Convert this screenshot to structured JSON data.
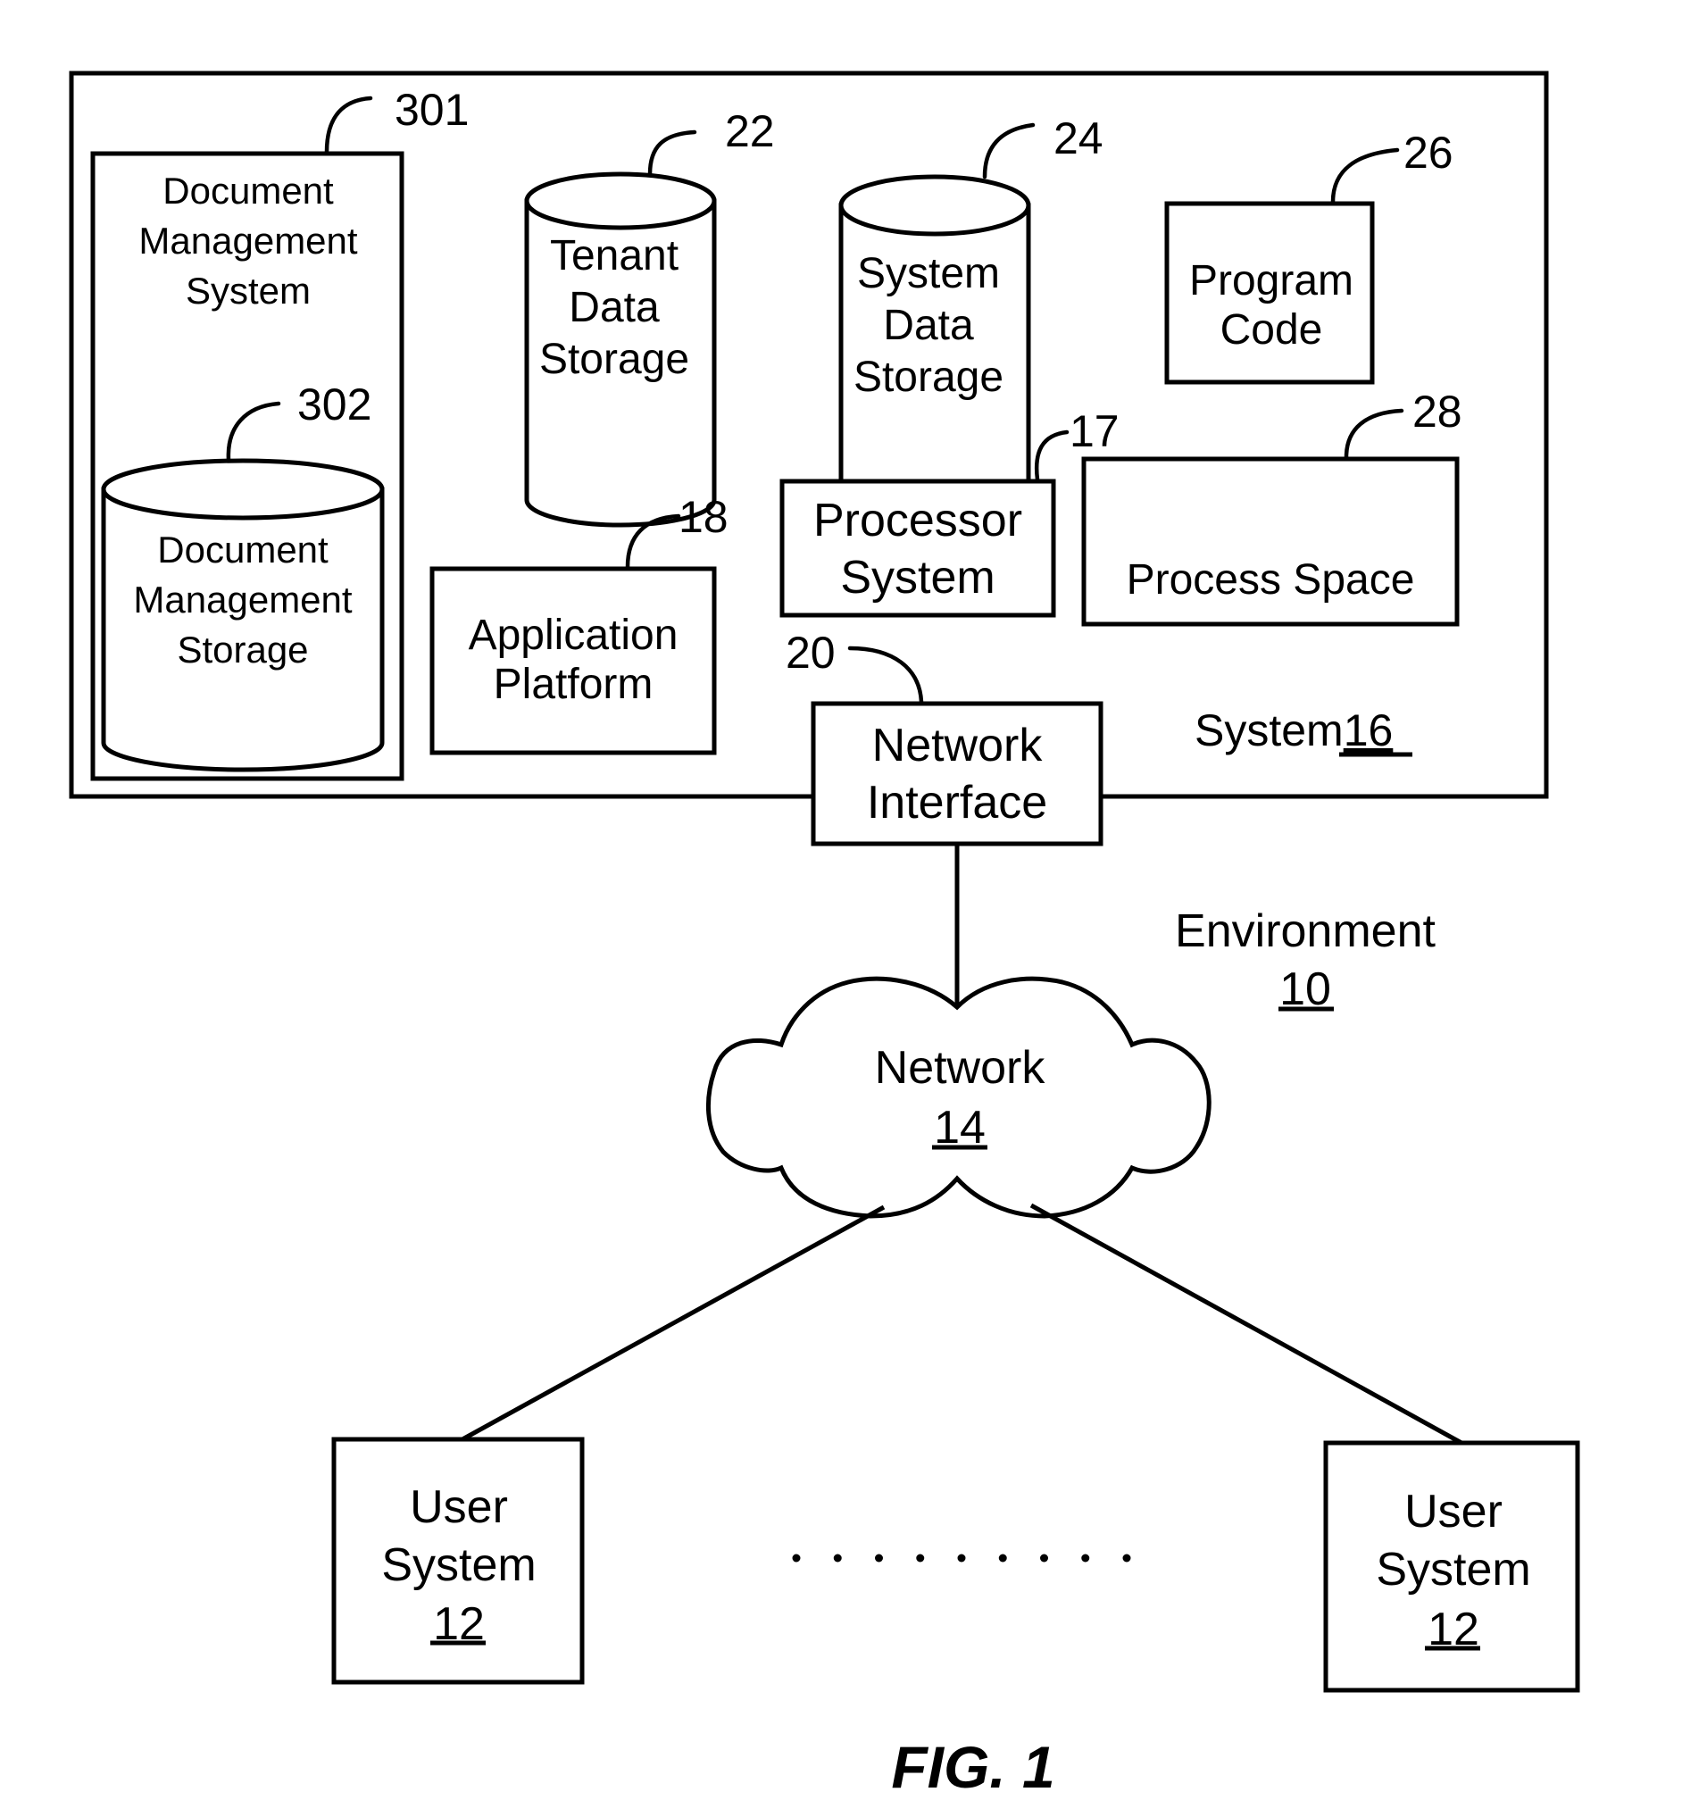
{
  "figure": {
    "caption": "FIG. 1",
    "environment": {
      "label": "Environment",
      "ref": "10"
    },
    "system": {
      "label": "System",
      "ref": "16"
    },
    "components": {
      "document_management_system": {
        "lines": [
          "Document",
          "Management",
          "System"
        ],
        "ref": "301"
      },
      "document_management_storage": {
        "lines": [
          "Document",
          "Management",
          "Storage"
        ],
        "ref": "302"
      },
      "tenant_data_storage": {
        "lines": [
          "Tenant",
          "Data",
          "Storage"
        ],
        "ref": "22"
      },
      "system_data_storage": {
        "lines": [
          "System",
          "Data",
          "Storage"
        ],
        "ref": "24"
      },
      "program_code": {
        "lines": [
          "Program",
          "Code"
        ],
        "ref": "26"
      },
      "processor_system": {
        "lines": [
          "Processor",
          "System"
        ],
        "ref": "17"
      },
      "process_space": {
        "lines": [
          "Process Space"
        ],
        "ref": "28"
      },
      "application_platform": {
        "lines": [
          "Application",
          "Platform"
        ],
        "ref": "18"
      },
      "network_interface": {
        "lines": [
          "Network",
          "Interface"
        ],
        "ref": "20"
      }
    },
    "network": {
      "label": "Network",
      "ref": "14"
    },
    "user_systems": [
      {
        "lines": [
          "User",
          "System"
        ],
        "ref": "12"
      },
      {
        "lines": [
          "User",
          "System"
        ],
        "ref": "12"
      }
    ],
    "ellipsis_dot_count": 9
  }
}
